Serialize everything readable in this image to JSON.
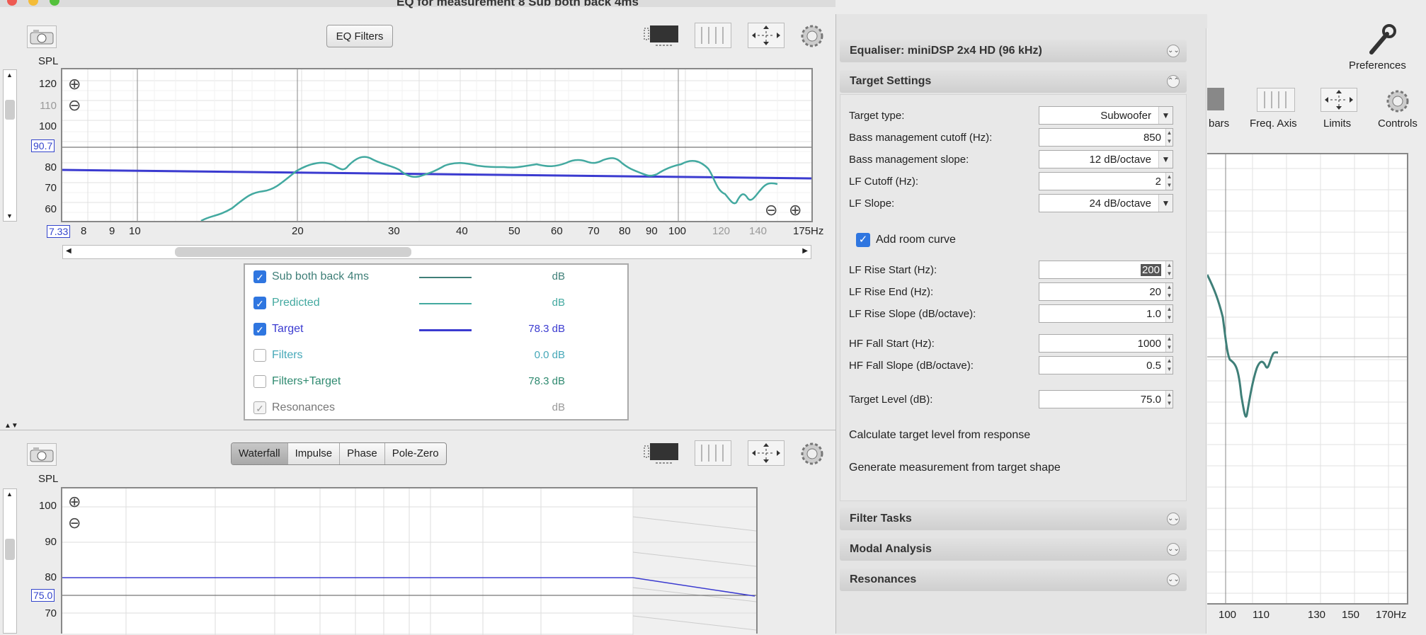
{
  "window": {
    "title": "EQ for measurement 8 Sub both back 4ms"
  },
  "top_toolbar": {
    "eq_filters": "EQ Filters"
  },
  "spl_graph": {
    "y_label": "SPL",
    "y_ticks": [
      "120",
      "110",
      "100",
      "80",
      "70",
      "60"
    ],
    "y_value_box": "90.7",
    "x_value_box": "7.33",
    "x_ticks": [
      "8",
      "9",
      "10",
      "20",
      "30",
      "40",
      "50",
      "60",
      "70",
      "80",
      "90",
      "100"
    ],
    "x_ticks_gray": [
      "120",
      "140"
    ],
    "x_end": "175Hz"
  },
  "legend": [
    {
      "name": "Sub both back 4ms",
      "value": "dB",
      "checked": true,
      "color": "#3f7f78"
    },
    {
      "name": "Predicted",
      "value": "dB",
      "checked": true,
      "color": "#43a9a0"
    },
    {
      "name": "Target",
      "value": "78.3 dB",
      "checked": true,
      "color": "#3b3bd0"
    },
    {
      "name": "Filters",
      "value": "0.0 dB",
      "checked": false,
      "color": "#46a8b8"
    },
    {
      "name": "Filters+Target",
      "value": "78.3 dB",
      "checked": false,
      "color": "#2f8a70"
    },
    {
      "name": "Resonances",
      "value": "dB",
      "checked": false,
      "color": "#999999"
    }
  ],
  "bottom_toolbar": {
    "tabs": [
      "Waterfall",
      "Impulse",
      "Phase",
      "Pole-Zero"
    ],
    "selected": "Waterfall"
  },
  "waterfall": {
    "y_label": "SPL",
    "y_ticks": [
      "100",
      "90",
      "80",
      "70"
    ],
    "value_box": "75.0"
  },
  "right_panel": {
    "equaliser": "Equaliser: miniDSP 2x4 HD (96 kHz)",
    "target_settings": "Target Settings",
    "target_type": {
      "label": "Target type:",
      "value": "Subwoofer"
    },
    "bm_cutoff": {
      "label": "Bass management cutoff (Hz):",
      "value": "850"
    },
    "bm_slope": {
      "label": "Bass management slope:",
      "value": "12 dB/octave"
    },
    "lf_cutoff": {
      "label": "LF Cutoff (Hz):",
      "value": "2"
    },
    "lf_slope": {
      "label": "LF Slope:",
      "value": "24 dB/octave"
    },
    "add_room_curve": "Add room curve",
    "lf_rise_start": {
      "label": "LF Rise Start (Hz):",
      "value": "200"
    },
    "lf_rise_end": {
      "label": "LF Rise End (Hz):",
      "value": "20"
    },
    "lf_rise_slope": {
      "label": "LF Rise Slope (dB/octave):",
      "value": "1.0"
    },
    "hf_fall_start": {
      "label": "HF Fall Start (Hz):",
      "value": "1000"
    },
    "hf_fall_slope": {
      "label": "HF Fall Slope (dB/octave):",
      "value": "0.5"
    },
    "target_level": {
      "label": "Target Level (dB):",
      "value": "75.0"
    },
    "calc_target": "Calculate target level from response",
    "gen_measurement": "Generate measurement from target shape",
    "filter_tasks": "Filter Tasks",
    "modal_analysis": "Modal Analysis",
    "resonances": "Resonances"
  },
  "bg_window": {
    "preferences": "Preferences",
    "toolbar": [
      "bars",
      "Freq. Axis",
      "Limits",
      "Controls"
    ],
    "x_ticks": [
      "100",
      "110",
      "130",
      "150",
      "170Hz"
    ]
  }
}
